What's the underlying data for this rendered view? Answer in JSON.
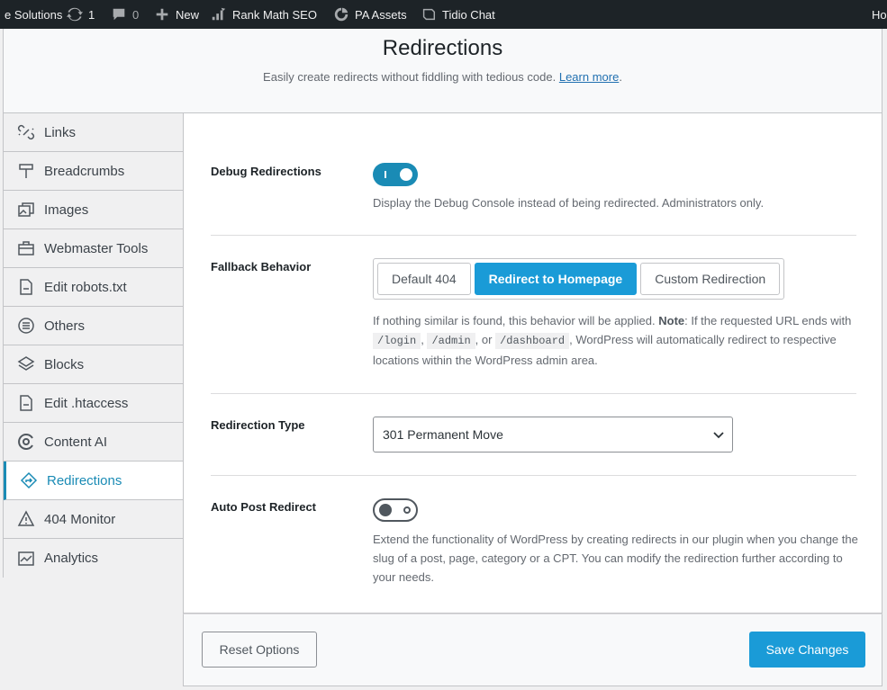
{
  "adminbar": {
    "site_name": "e Solutions",
    "updates_count": "1",
    "comments_count": "0",
    "new_label": "New",
    "rankmath_label": "Rank Math SEO",
    "pa_assets_label": "PA Assets",
    "tidio_label": "Tidio Chat",
    "howdy_label": "Ho"
  },
  "header": {
    "title": "Redirections",
    "subtitle": "Easily create redirects without fiddling with tedious code.",
    "learn_more": "Learn more",
    "period": "."
  },
  "sidebar": {
    "items": [
      {
        "label": "Links",
        "icon": "links-icon"
      },
      {
        "label": "Breadcrumbs",
        "icon": "signpost-icon"
      },
      {
        "label": "Images",
        "icon": "images-icon"
      },
      {
        "label": "Webmaster Tools",
        "icon": "briefcase-icon"
      },
      {
        "label": "Edit robots.txt",
        "icon": "file-icon"
      },
      {
        "label": "Others",
        "icon": "list-circle-icon"
      },
      {
        "label": "Blocks",
        "icon": "blocks-icon"
      },
      {
        "label": "Edit .htaccess",
        "icon": "file-icon"
      },
      {
        "label": "Content AI",
        "icon": "content-ai-icon"
      },
      {
        "label": "Redirections",
        "icon": "redirect-icon",
        "active": true
      },
      {
        "label": "404 Monitor",
        "icon": "warning-icon"
      },
      {
        "label": "Analytics",
        "icon": "analytics-icon"
      }
    ]
  },
  "settings": {
    "debug": {
      "label": "Debug Redirections",
      "enabled": true,
      "description": "Display the Debug Console instead of being redirected. Administrators only."
    },
    "fallback": {
      "label": "Fallback Behavior",
      "options": [
        "Default 404",
        "Redirect to Homepage",
        "Custom Redirection"
      ],
      "selected": "Redirect to Homepage",
      "desc_before": "If nothing similar is found, this behavior will be applied. ",
      "desc_note": "Note",
      "desc_mid": ": If the requested URL ends with ",
      "code1": "/login",
      "sep1": ", ",
      "code2": "/admin",
      "sep2": ", or ",
      "code3": "/dashboard",
      "desc_after": ", WordPress will automatically redirect to respective locations within the WordPress admin area."
    },
    "redirection_type": {
      "label": "Redirection Type",
      "value": "301 Permanent Move"
    },
    "auto_post": {
      "label": "Auto Post Redirect",
      "enabled": false,
      "description": "Extend the functionality of WordPress by creating redirects in our plugin when you change the slug of a post, page, category or a CPT. You can modify the redirection further according to your needs."
    }
  },
  "footer": {
    "reset_label": "Reset Options",
    "save_label": "Save Changes"
  },
  "colors": {
    "accent": "#1a9bd7",
    "active_tab": "#1a8bb5",
    "adminbar_bg": "#1d2327"
  }
}
